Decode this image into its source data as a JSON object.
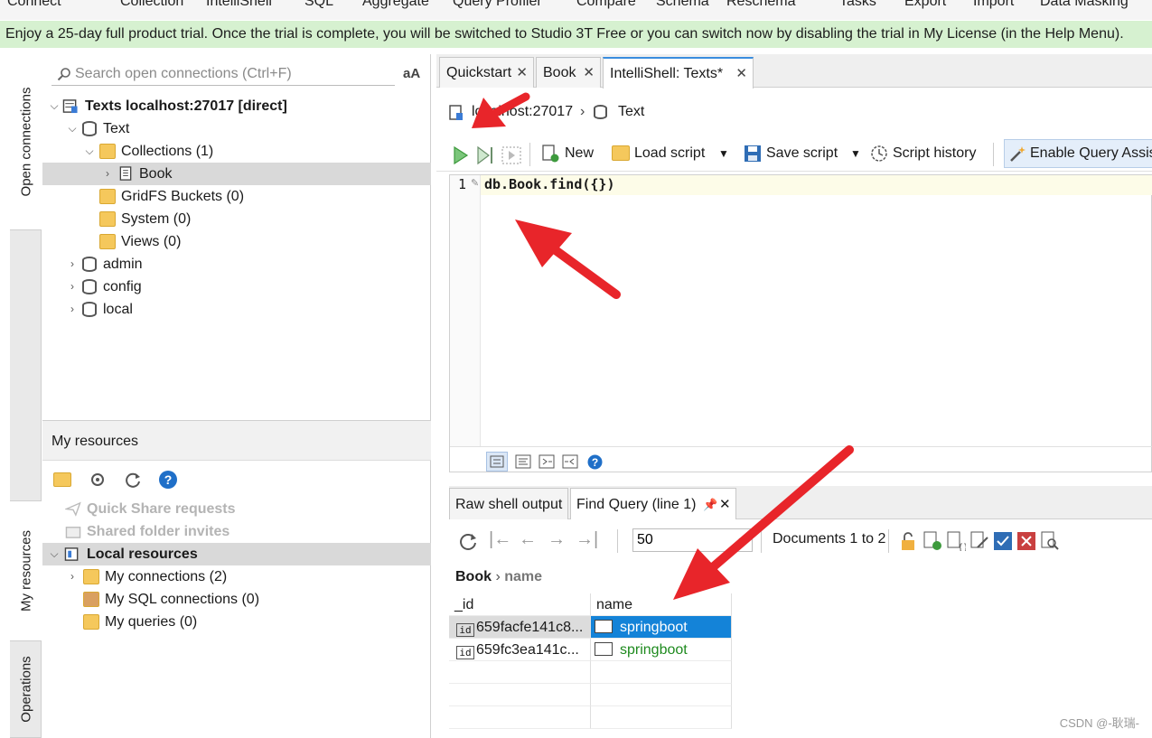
{
  "menu": {
    "items": [
      "Connect",
      "Collection",
      "IntelliShell",
      "SQL",
      "Aggregate",
      "Query Profiler",
      "Compare",
      "Schema",
      "Reschema",
      "Tasks",
      "Export",
      "Import",
      "Data Masking"
    ]
  },
  "banner": {
    "text": "Enjoy a 25-day full product trial. Once the trial is complete, you will be switched to Studio 3T Free or you can switch now by disabling the trial in My License (in the Help Menu)."
  },
  "side_tabs": {
    "open_connections": "Open connections",
    "my_resources": "My resources",
    "operations": "Operations"
  },
  "connections": {
    "search_placeholder": "Search open connections (Ctrl+F)",
    "font_toggle": "aA",
    "tree": {
      "connection": "Texts localhost:27017 [direct]",
      "database": "Text",
      "collections": "Collections (1)",
      "book": "Book",
      "gridfs": "GridFS Buckets (0)",
      "system": "System (0)",
      "views": "Views (0)",
      "admin": "admin",
      "config": "config",
      "local": "local"
    }
  },
  "my_resources": {
    "title": "My resources",
    "quick_share": "Quick Share requests",
    "shared_folder": "Shared folder invites",
    "local_resources": "Local resources",
    "my_connections": "My connections (2)",
    "my_sql_connections": "My SQL connections (0)",
    "my_queries": "My queries (0)"
  },
  "tabs": {
    "quickstart": "Quickstart",
    "book": "Book",
    "intellishell": "IntelliShell: Texts*"
  },
  "breadcrumb": {
    "host": "localhost:27017",
    "db": "Text"
  },
  "toolbar": {
    "new": "New",
    "load_script": "Load script",
    "save_script": "Save script",
    "script_history": "Script history",
    "query_assist": "Enable Query Assis"
  },
  "editor": {
    "line_number": "1",
    "code": "db.Book.find({})"
  },
  "results": {
    "raw_tab": "Raw shell output",
    "find_tab": "Find Query (line 1)",
    "page_size": "50",
    "documents": "Documents 1 to 2",
    "path_collection": "Book",
    "path_field": "name",
    "columns": [
      "_id",
      "name"
    ],
    "id_badge": "id",
    "rows": [
      {
        "id": "659facfe141c8...",
        "name": "springboot"
      },
      {
        "id": "659fc3ea141c...",
        "name": "springboot"
      }
    ]
  },
  "watermark": "CSDN @-耿瑞-",
  "colors": {
    "banner_bg": "#d6f1d0",
    "selection": "#1483d8",
    "arrow": "#e8252a",
    "string_value": "#1e8a1e"
  }
}
